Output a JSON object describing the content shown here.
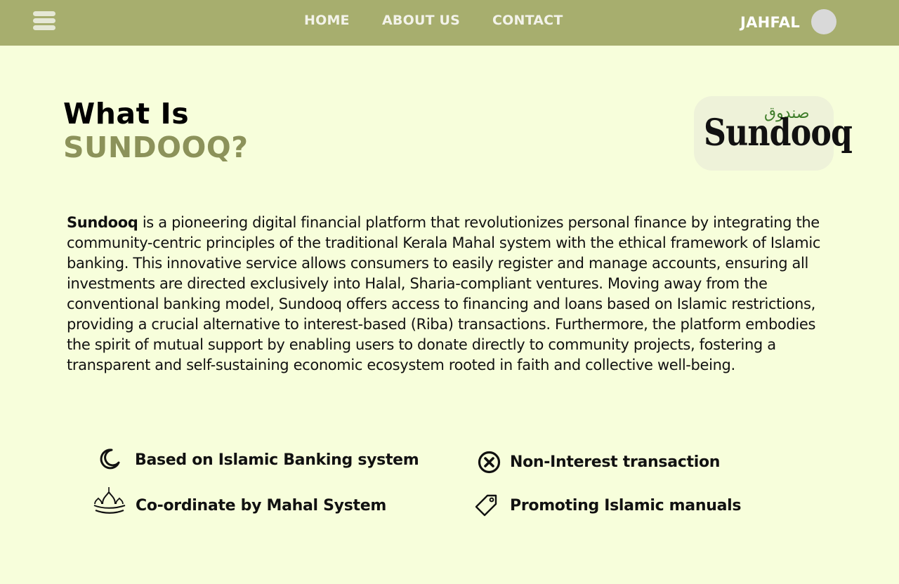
{
  "header": {
    "menu_icon": "hamburger-icon",
    "nav": [
      {
        "label": "HOME"
      },
      {
        "label": "ABOUT US"
      },
      {
        "label": "CONTACT"
      }
    ],
    "user_name": "JAHFAL",
    "colors": {
      "bar": "#a7ae6e",
      "nav_text": "#f3f3ea"
    }
  },
  "hero": {
    "title_line1": "What Is",
    "title_line2": "SUNDOOQ?",
    "logo_arabic": "صندوق",
    "logo_latin": "Sundooq",
    "accent_color": "#8c925a"
  },
  "description": {
    "brand": "Sundooq",
    "text": " is a pioneering digital financial platform that revolutionizes personal finance by integrating the community-centric principles of the traditional Kerala Mahal system with the ethical framework of Islamic banking. This innovative service allows consumers to easily register and manage accounts, ensuring all investments are directed exclusively into Halal, Sharia-compliant ventures. Moving away from the conventional banking model, Sundooq offers access to financing and loans based on Islamic restrictions, providing a crucial alternative to interest-based (Riba) transactions. Furthermore, the platform embodies the spirit of mutual support by enabling users to donate directly to community projects, fostering a transparent and self-sustaining economic ecosystem rooted in faith and collective well-being."
  },
  "features": [
    {
      "label": "Based on Islamic Banking system",
      "icon": "crescent-moon-icon"
    },
    {
      "label": "Non-Interest transaction",
      "icon": "x-circle-icon"
    },
    {
      "label": "Co-ordinate by Mahal System",
      "icon": "mosque-icon"
    },
    {
      "label": "Promoting Islamic manuals",
      "icon": "tag-icon"
    }
  ],
  "page": {
    "background": "#f7fedb"
  }
}
